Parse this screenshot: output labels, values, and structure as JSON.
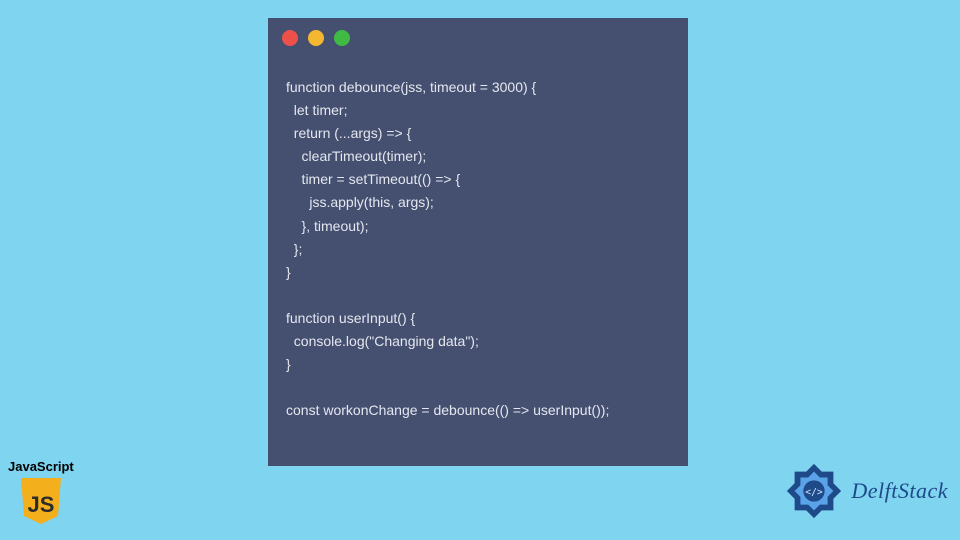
{
  "window": {
    "buttons": [
      "close",
      "minimize",
      "zoom"
    ]
  },
  "code_lines": [
    "function debounce(jss, timeout = 3000) {",
    "  let timer;",
    "  return (...args) => {",
    "    clearTimeout(timer);",
    "    timer = setTimeout(() => {",
    "      jss.apply(this, args);",
    "    }, timeout);",
    "  };",
    "}",
    "",
    "function userInput() {",
    "  console.log(\"Changing data\");",
    "}",
    "",
    "const workonChange = debounce(() => userInput());"
  ],
  "js_badge": {
    "label": "JavaScript",
    "shield_bg": "#f3af1c",
    "shield_text": "JS"
  },
  "delft": {
    "text": "DelftStack"
  }
}
